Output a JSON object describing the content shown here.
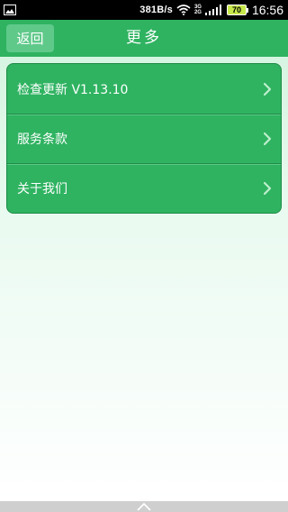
{
  "status_bar": {
    "net_speed": "381B/s",
    "net_3g": "3G",
    "net_2g": "2G",
    "battery": "70",
    "time": "16:56"
  },
  "header": {
    "back_label": "返回",
    "title": "更多"
  },
  "menu": {
    "items": [
      {
        "label": "检查更新 V1.13.10",
        "icon": "chevron-right-icon"
      },
      {
        "label": "服务条款",
        "icon": "chevron-right-icon"
      },
      {
        "label": "关于我们",
        "icon": "chevron-right-icon"
      }
    ]
  },
  "colors": {
    "header_green": "#2fb361",
    "button_green": "#5fc98a",
    "card_border": "#1f8b47"
  }
}
